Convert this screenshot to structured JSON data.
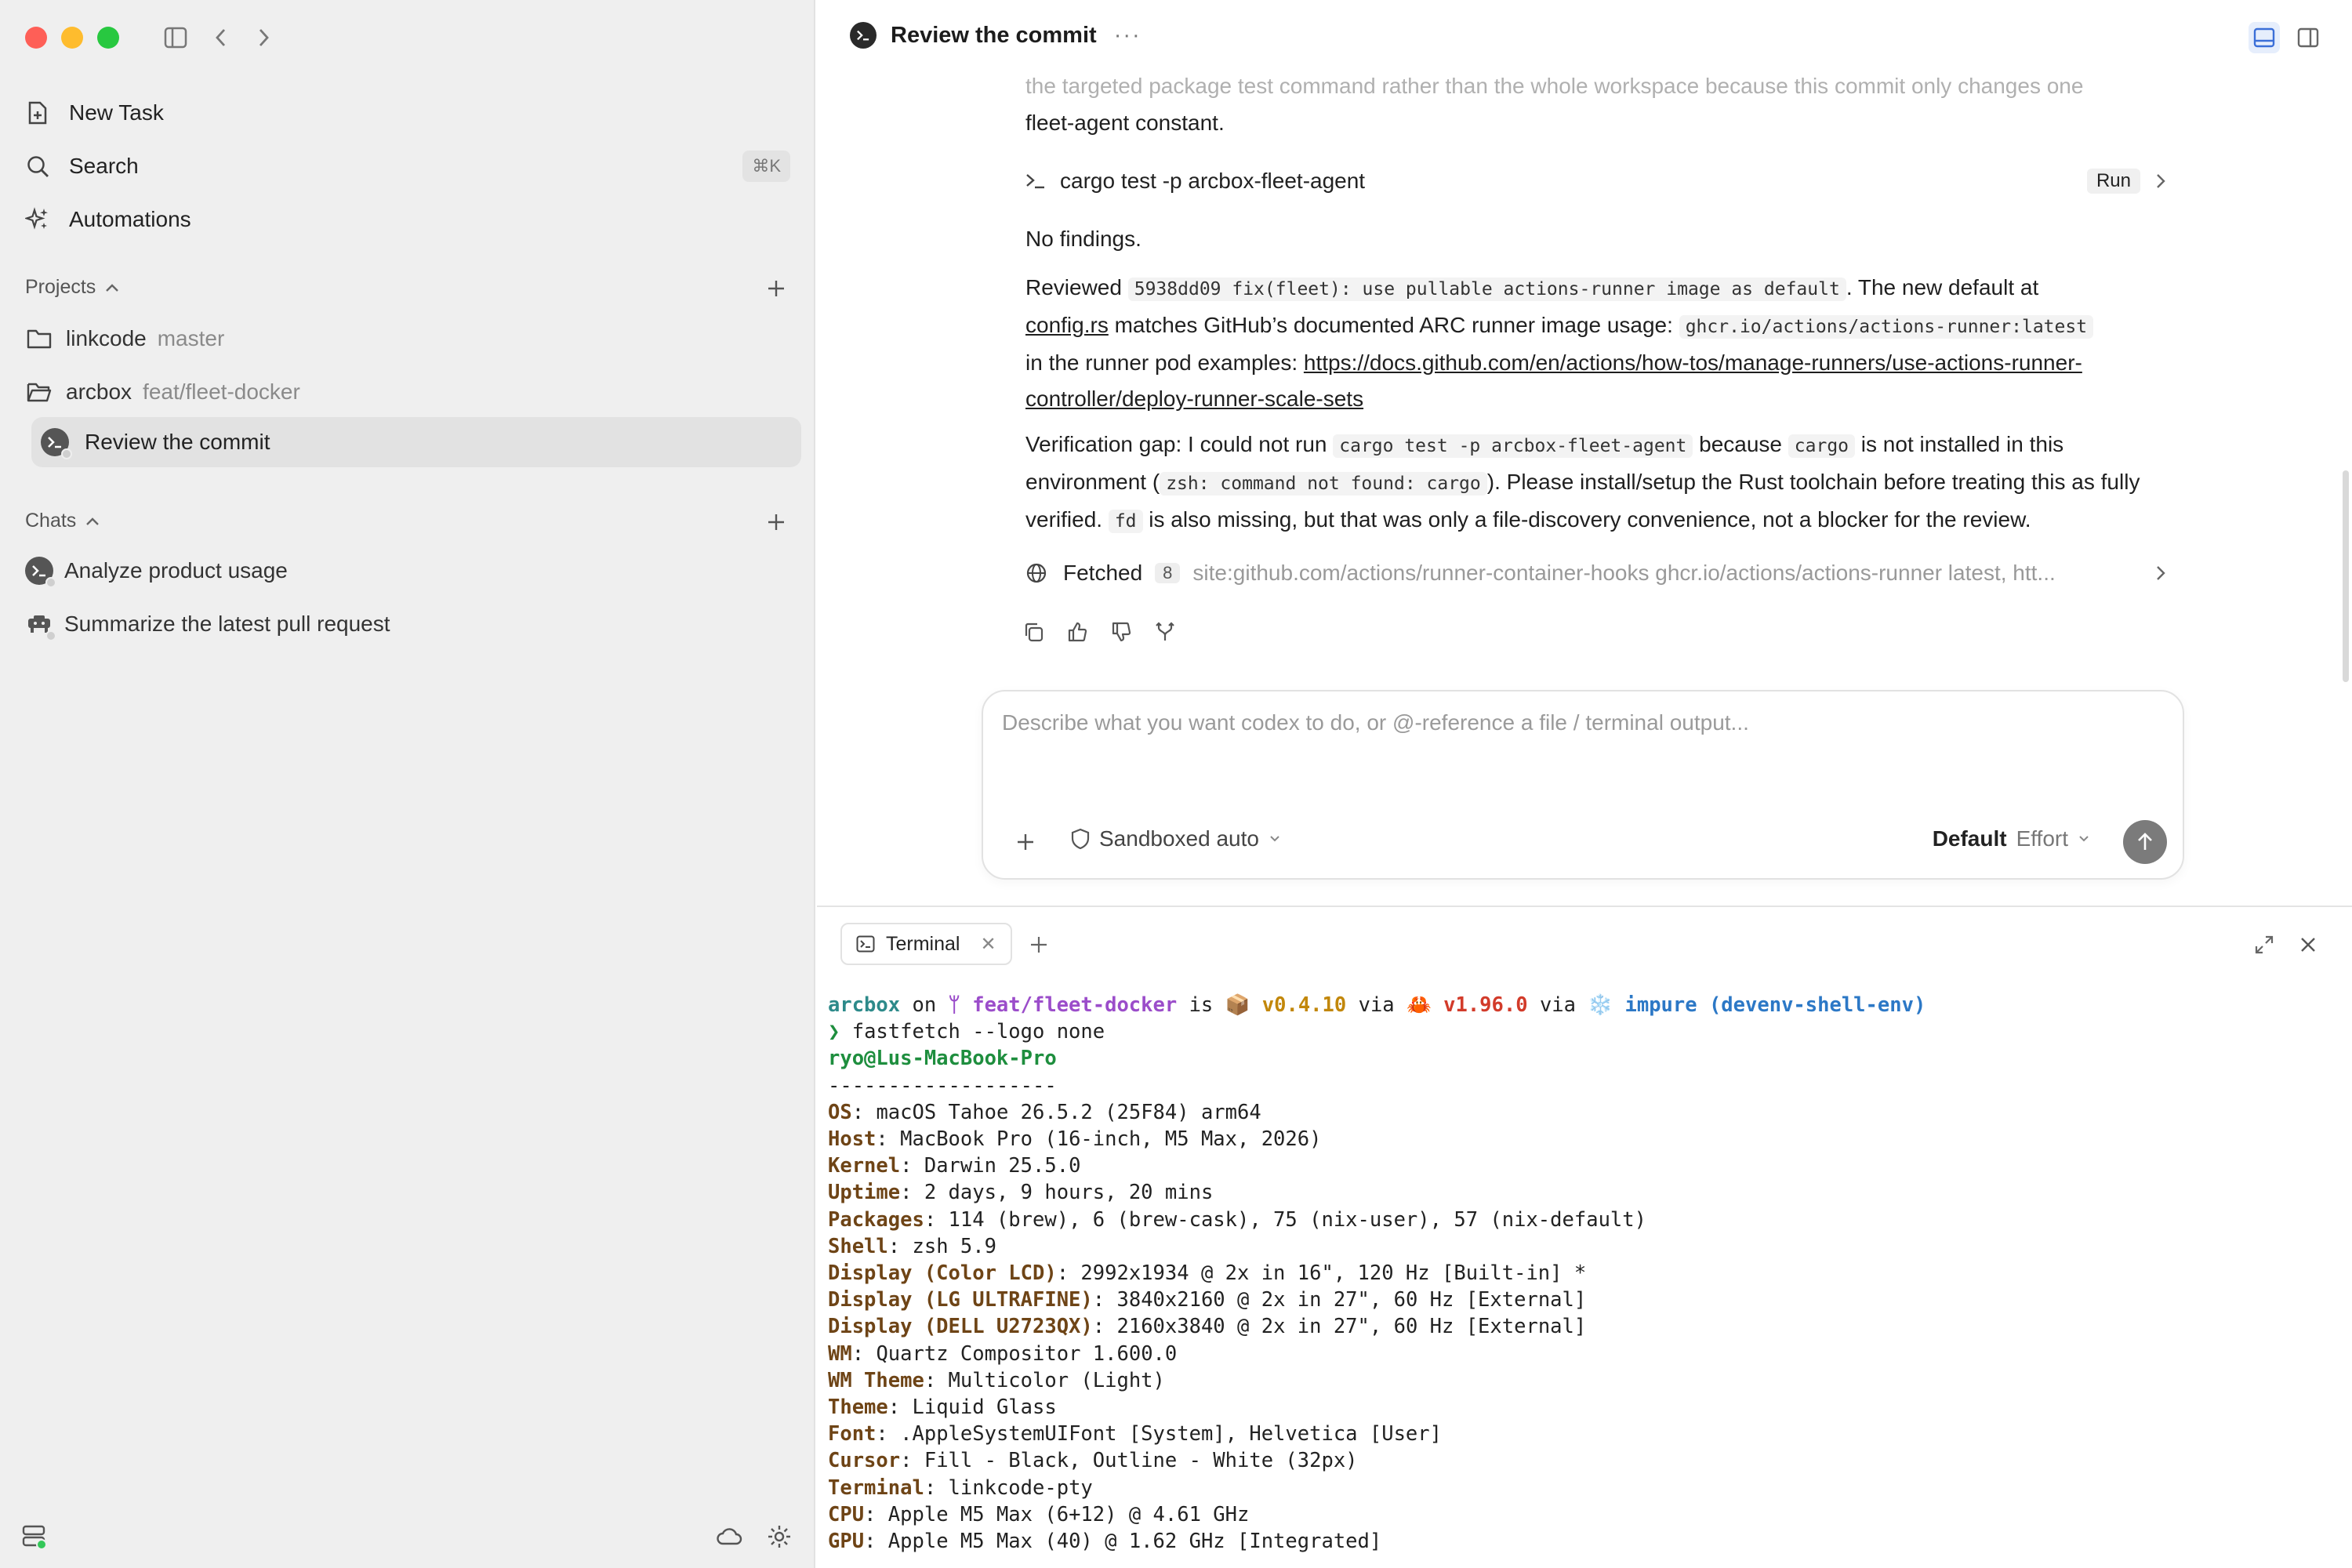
{
  "sidebar": {
    "nav": [
      {
        "label": "New Task",
        "icon": "new-task-icon"
      },
      {
        "label": "Search",
        "icon": "search-icon",
        "shortcut": "⌘K"
      },
      {
        "label": "Automations",
        "icon": "automations-icon"
      }
    ],
    "projects_label": "Projects",
    "projects": [
      {
        "name": "linkcode",
        "branch": "master"
      },
      {
        "name": "arcbox",
        "branch": "feat/fleet-docker"
      }
    ],
    "active_task": "Review the commit",
    "chats_label": "Chats",
    "chats": [
      {
        "label": "Analyze product usage"
      },
      {
        "label": "Summarize the latest pull request"
      }
    ]
  },
  "header": {
    "title": "Review the commit",
    "more": "···"
  },
  "conversation": {
    "faded_line": "the targeted package test command rather than the whole workspace because this commit only changes one",
    "line2": "fleet-agent constant.",
    "command": "cargo test -p arcbox-fleet-agent",
    "run_label": "Run",
    "no_findings": "No findings.",
    "p1_a": "Reviewed ",
    "p1_code1": "5938dd09 fix(fleet): use pullable actions-runner image as default",
    "p1_b": ". The new default at",
    "p1_link1": "config.rs",
    "p1_c": " matches GitHub’s documented ARC runner image usage: ",
    "p1_code2": "ghcr.io/actions/actions-runner:latest",
    "p1_d": "in the runner pod examples: ",
    "p1_link2": "https://docs.github.com/en/actions/how-tos/manage-runners/use-actions-runner-controller/deploy-runner-scale-sets",
    "p2_a": "Verification gap: I could not run ",
    "p2_code1": "cargo test -p arcbox-fleet-agent",
    "p2_b": " because ",
    "p2_code2": "cargo",
    "p2_c": " is not installed in this environment (",
    "p2_code3": "zsh: command not found: cargo",
    "p2_d": "). Please install/setup the Rust toolchain before treating this as fully verified. ",
    "p2_code4": "fd",
    "p2_e": " is also missing, but that was only a file-discovery convenience, not a blocker for the review.",
    "fetched_label": "Fetched",
    "fetched_count": "8",
    "fetched_query": "site:github.com/actions/runner-container-hooks ghcr.io/actions/actions-runner latest, htt..."
  },
  "composer": {
    "placeholder": "Describe what you want codex to do, or @-reference a file / terminal output...",
    "sandbox": "Sandboxed auto",
    "model": "Default",
    "effort": "Effort"
  },
  "terminal": {
    "tab_label": "Terminal",
    "prompt": {
      "dir": "arcbox",
      "on": " on ",
      "branch_icon": "ᛘ",
      "branch": "feat/fleet-docker",
      "is": " is ",
      "pkg_icon": "📦",
      "version": "v0.4.10",
      "via1": " via ",
      "rust_icon": "🦀",
      "rust_version": "v1.96.0",
      "via2": " via ",
      "nix_icon": "❄️",
      "nix": "impure (devenv-shell-env)"
    },
    "command_prompt": "❯",
    "command": " fastfetch --logo none",
    "user": "ryo@Lus-MacBook-Pro",
    "separator": "-------------------",
    "info": [
      {
        "key": "OS",
        "value": "macOS Tahoe 26.5.2 (25F84) arm64"
      },
      {
        "key": "Host",
        "value": "MacBook Pro (16-inch, M5 Max, 2026)"
      },
      {
        "key": "Kernel",
        "value": "Darwin 25.5.0"
      },
      {
        "key": "Uptime",
        "value": "2 days, 9 hours, 20 mins"
      },
      {
        "key": "Packages",
        "value": "114 (brew), 6 (brew-cask), 75 (nix-user), 57 (nix-default)"
      },
      {
        "key": "Shell",
        "value": "zsh 5.9"
      },
      {
        "key": "Display (Color LCD)",
        "value": "2992x1934 @ 2x in 16\", 120 Hz [Built-in] *"
      },
      {
        "key": "Display (LG ULTRAFINE)",
        "value": "3840x2160 @ 2x in 27\", 60 Hz [External]"
      },
      {
        "key": "Display (DELL U2723QX)",
        "value": "2160x3840 @ 2x in 27\", 60 Hz [External]"
      },
      {
        "key": "WM",
        "value": "Quartz Compositor 1.600.0"
      },
      {
        "key": "WM Theme",
        "value": "Multicolor (Light)"
      },
      {
        "key": "Theme",
        "value": "Liquid Glass"
      },
      {
        "key": "Font",
        "value": ".AppleSystemUIFont [System], Helvetica [User]"
      },
      {
        "key": "Cursor",
        "value": "Fill - Black, Outline - White (32px)"
      },
      {
        "key": "Terminal",
        "value": "linkcode-pty"
      },
      {
        "key": "CPU",
        "value": "Apple M5 Max (6+12) @ 4.61 GHz"
      },
      {
        "key": "GPU",
        "value": "Apple M5 Max (40) @ 1.62 GHz [Integrated]"
      }
    ]
  }
}
